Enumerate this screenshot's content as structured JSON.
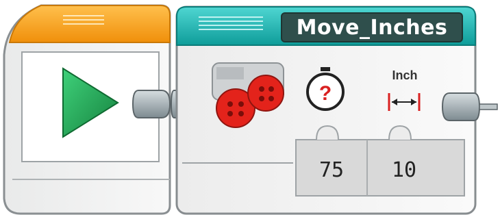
{
  "start_block": {
    "icon": "play-icon"
  },
  "move_block": {
    "title": "Move_Inches",
    "motor_icon": "large-motors-icon",
    "power_mode_icon": "speedometer-question-icon",
    "unit_label": "Inch",
    "unit_icon": "distance-arrow-icon",
    "inputs": [
      {
        "name": "power",
        "value": "75"
      },
      {
        "name": "distance",
        "value": "10"
      }
    ]
  },
  "colors": {
    "start_header": "#f7a21b",
    "move_header": "#17b3b0",
    "play_green": "#1e9b50",
    "motor_red": "#e3231b",
    "unit_red": "#d92020",
    "connector_gray": "#aab6bb"
  }
}
